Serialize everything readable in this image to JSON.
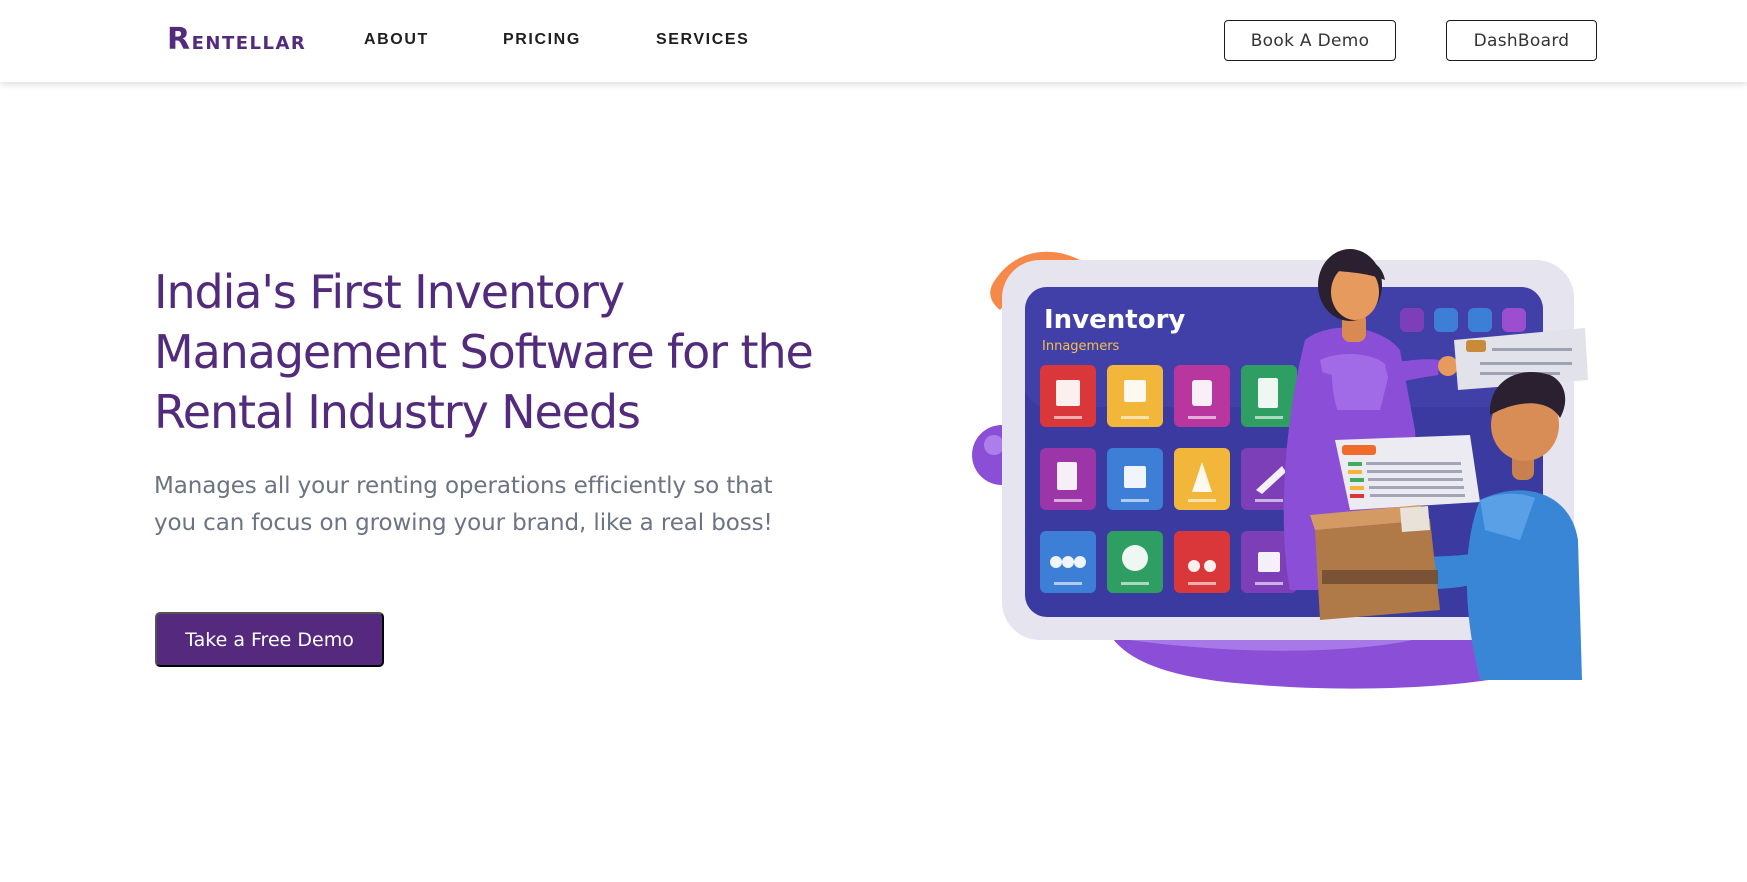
{
  "nav": {
    "logo": {
      "first_letter": "R",
      "rest": "ENTELLAR"
    },
    "links": [
      "ABOUT",
      "PRICING",
      "SERVICES"
    ],
    "book_demo_label": "Book A Demo",
    "dashboard_label": "DashBoard"
  },
  "hero": {
    "title": "India's First Inventory Management Software for the Rental Industry Needs",
    "subtitle": "Manages all your renting operations efficiently so that you can focus on growing your brand, like a real boss!",
    "cta_label": "Take a Free Demo"
  },
  "illustration": {
    "screen_title": "Inventory",
    "screen_subtitle": "Innagemers",
    "colors": {
      "brand": "#522b7d",
      "screen": "#3b3aa0",
      "tile_red": "#d9373a",
      "tile_yellow": "#f2b63a",
      "tile_magenta": "#b8369e",
      "tile_green": "#2f9e62",
      "tile_blue": "#3d7fd6",
      "tile_purple": "#7c3fb8",
      "accent_orange": "#f5894a"
    }
  }
}
